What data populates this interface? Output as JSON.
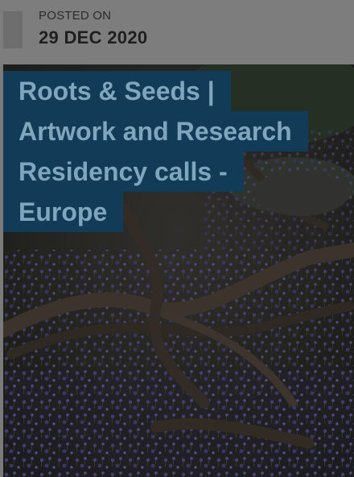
{
  "post": {
    "posted_label": "POSTED ON",
    "posted_date": "29 DEC 2020",
    "title_lines": [
      "Roots & Seeds |",
      "Artwork and Research",
      "Residency calls -",
      "Europe"
    ]
  },
  "colors": {
    "title_background": "#123b57",
    "title_text": "#7fa6bd",
    "meta_background": "#7d7d7d"
  }
}
